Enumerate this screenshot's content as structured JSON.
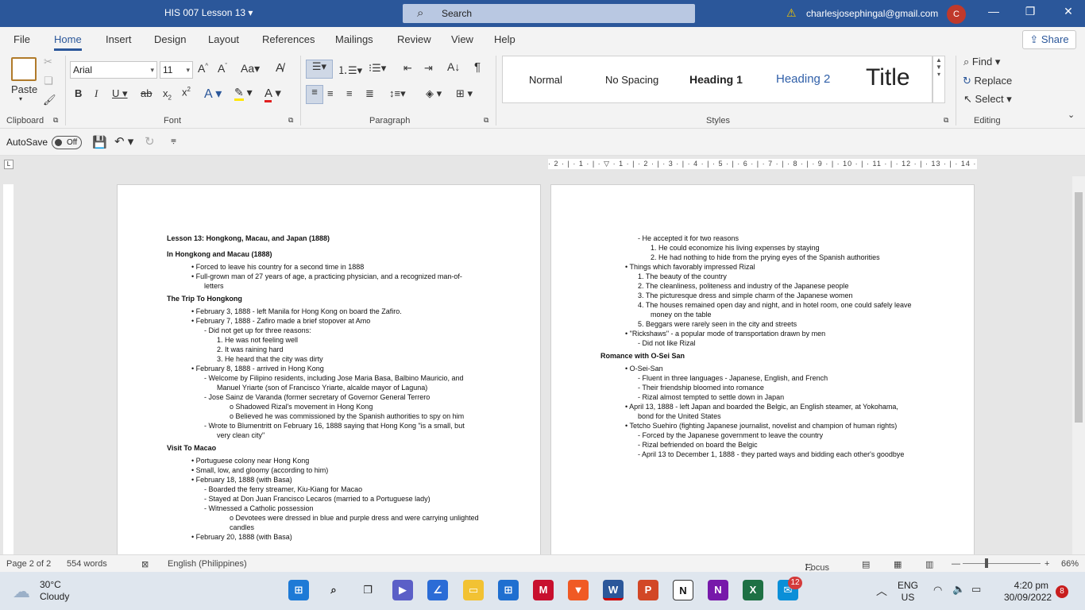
{
  "titlebar": {
    "doc_title": "HIS 007 Lesson 13",
    "search_placeholder": "Search",
    "account": "charlesjosephingal@gmail.com",
    "avatar_initial": "C"
  },
  "menu": {
    "tabs": [
      "File",
      "Home",
      "Insert",
      "Design",
      "Layout",
      "References",
      "Mailings",
      "Review",
      "View",
      "Help"
    ],
    "active": "Home",
    "share_label": "Share"
  },
  "ribbon": {
    "paste_label": "Paste",
    "font_name": "Arial",
    "font_size": "11",
    "groups": {
      "clipboard": "Clipboard",
      "font": "Font",
      "paragraph": "Paragraph",
      "styles": "Styles",
      "editing": "Editing"
    },
    "styles": [
      "Normal",
      "No Spacing",
      "Heading 1",
      "Heading 2",
      "Title"
    ],
    "find_label": "Find",
    "replace_label": "Replace",
    "select_label": "Select"
  },
  "qat": {
    "autosave_label": "AutoSave",
    "autosave_state": "Off"
  },
  "ruler": {
    "labels": "· 2 · | · 1 · | · ▽ · 1 · | · 2 · | · 3 · | · 4 · | · 5 · | · 6 · | · 7 · | · 8 · | · 9 · | · 10 · | · 11 · | · 12 · | · 13 · | · 14 · | · 15 · | · 16 ·  17 · | · 18 · | · 19"
  },
  "document": {
    "page1": [
      {
        "t": "Lesson 13: Hongkong, Macau, and Japan (1888)",
        "indent": 0,
        "bold": true
      },
      {
        "t": "In Hongkong and Macau (1888)",
        "indent": 0,
        "bold": true
      },
      {
        "t": "•   Forced to leave his country for a second time in 1888",
        "indent": 1
      },
      {
        "t": "•   Full-grown man of 27 years of age, a practicing physician, and a recognized man-of-",
        "indent": 1
      },
      {
        "t": "letters",
        "indent": 2
      },
      {
        "t": "The Trip To Hongkong",
        "indent": 0,
        "bold": true
      },
      {
        "t": "•   February 3, 1888 - left Manila for Hong Kong on board the Zafiro.",
        "indent": 1
      },
      {
        "t": "•   February 7, 1888 - Zafiro made a brief stopover at Amo",
        "indent": 1
      },
      {
        "t": "-   Did not get up for three reasons:",
        "indent": 2
      },
      {
        "t": "1.  He was not feeling well",
        "indent": 3
      },
      {
        "t": "2.  It was raining hard",
        "indent": 3
      },
      {
        "t": "3.  He heard that the city was dirty",
        "indent": 3
      },
      {
        "t": "•   February 8, 1888 - arrived in Hong Kong",
        "indent": 1
      },
      {
        "t": "-   Welcome by Filipino residents, including Jose Maria Basa, Balbino Mauricio, and",
        "indent": 2
      },
      {
        "t": "Manuel Yriarte (son of Francisco Yriarte, alcalde mayor of Laguna)",
        "indent": 3
      },
      {
        "t": "-   Jose Sainz de Varanda (former secretary of Governor General Terrero",
        "indent": 2
      },
      {
        "t": "o   Shadowed Rizal's movement in Hong Kong",
        "indent": 4
      },
      {
        "t": "o   Believed he was commissioned by the Spanish authorities to spy on him",
        "indent": 4
      },
      {
        "t": "-   Wrote to Blumentritt on February 16, 1888 saying that Hong Kong \"is a small, but",
        "indent": 2
      },
      {
        "t": "very clean city\"",
        "indent": 3
      },
      {
        "t": "Visit To Macao",
        "indent": 0,
        "bold": true
      },
      {
        "t": "•   Portuguese colony near Hong Kong",
        "indent": 1
      },
      {
        "t": "•   Small, low, and gloomy (according to him)",
        "indent": 1
      },
      {
        "t": "•   February 18, 1888 (with Basa)",
        "indent": 1
      },
      {
        "t": "-   Boarded the ferry streamer, Kiu-Kiang for Macao",
        "indent": 2
      },
      {
        "t": "-   Stayed at Don Juan Francisco Lecaros (married to a Portuguese lady)",
        "indent": 2
      },
      {
        "t": "-   Witnessed a Catholic possession",
        "indent": 2
      },
      {
        "t": "o   Devotees were dressed in blue and purple dress and were carrying unlighted",
        "indent": 4
      },
      {
        "t": "candles",
        "indent": 5
      },
      {
        "t": "•   February 20, 1888 (with Basa)",
        "indent": 1
      }
    ],
    "page2": [
      {
        "t": "-   He accepted it for two reasons",
        "indent": 2
      },
      {
        "t": "1.  He could economize his living expenses by staying",
        "indent": 3
      },
      {
        "t": "2.  He had nothing to hide from the prying eyes of the Spanish authorities",
        "indent": 3
      },
      {
        "t": "•   Things which favorably impressed Rizal",
        "indent": 1
      },
      {
        "t": "1.  The beauty of the country",
        "indent": 2
      },
      {
        "t": "2.  The cleanliness, politeness and industry of the Japanese people",
        "indent": 2
      },
      {
        "t": "3.  The picturesque dress and simple charm of the Japanese women",
        "indent": 2
      },
      {
        "t": "4.  The houses remained open day and night, and in hotel room, one could safely leave",
        "indent": 2
      },
      {
        "t": "money on the table",
        "indent": 3
      },
      {
        "t": "5.  Beggars were rarely seen in the city and streets",
        "indent": 2
      },
      {
        "t": "•   \"Rickshaws\" - a popular mode of transportation drawn by men",
        "indent": 1
      },
      {
        "t": "-   Did not like Rizal",
        "indent": 2
      },
      {
        "t": "Romance with O-Sei San",
        "indent": 0,
        "bold": true
      },
      {
        "t": "•   O-Sei-San",
        "indent": 1
      },
      {
        "t": "-   Fluent in three languages - Japanese, English, and French",
        "indent": 2
      },
      {
        "t": "-   Their friendship bloomed into romance",
        "indent": 2
      },
      {
        "t": "-   Rizal almost tempted to settle down in Japan",
        "indent": 2
      },
      {
        "t": "•   April 13, 1888 - left Japan and boarded the Belgic, an English steamer, at Yokohama,",
        "indent": 1
      },
      {
        "t": "bond for the United States",
        "indent": 2
      },
      {
        "t": "•   Tetcho Suehiro (fighting Japanese journalist, novelist and champion of human rights)",
        "indent": 1
      },
      {
        "t": "-   Forced by the Japanese government to leave the country",
        "indent": 2
      },
      {
        "t": "-   Rizal befriended on board the Belgic",
        "indent": 2
      },
      {
        "t": "-   April 13 to December 1, 1888 - they parted ways and bidding each other's goodbye",
        "indent": 2
      }
    ]
  },
  "status": {
    "page": "Page 2 of 2",
    "words": "554 words",
    "language": "English (Philippines)",
    "focus": "Focus",
    "zoom": "66%"
  },
  "taskbar": {
    "temp": "30°C",
    "condition": "Cloudy",
    "lang_top": "ENG",
    "lang_bottom": "US",
    "time": "4:20 pm",
    "date": "30/09/2022",
    "badge_count": "12",
    "notif_count": "8"
  }
}
